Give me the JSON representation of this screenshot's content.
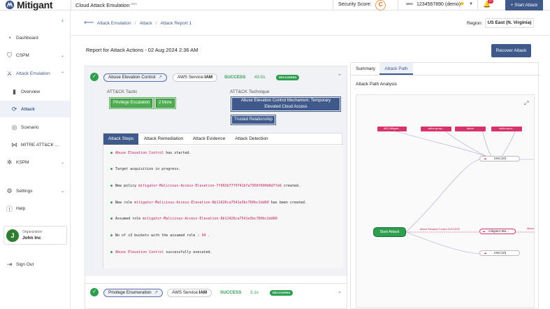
{
  "topbar": {
    "brand": "Mitigant",
    "app_title": "Cloud Attack Emulation",
    "aws_mark": "aws",
    "security_score_label": "Security Score:",
    "security_score_grade": "C",
    "account_aws_mark": "aws",
    "account": "1234567890 (demo)",
    "notification_count": "27",
    "start_attack": "+ Start Attack"
  },
  "sidebar": {
    "items": [
      {
        "label": "Dashboard",
        "icon": "dashboard-icon"
      },
      {
        "label": "CSPM",
        "icon": "cspm-icon"
      },
      {
        "label": "Attack Emulation",
        "icon": "attack-emulation-icon"
      },
      {
        "label": "Overview",
        "icon": "overview-icon"
      },
      {
        "label": "Attack",
        "icon": "attack-icon"
      },
      {
        "label": "Scenario",
        "icon": "scenario-icon"
      },
      {
        "label": "MITRE ATT&CK ...",
        "icon": "mitre-icon"
      },
      {
        "label": "KSPM",
        "icon": "kspm-icon"
      },
      {
        "label": "Settings",
        "icon": "gear-icon"
      },
      {
        "label": "Help",
        "icon": "help-icon"
      },
      {
        "label": "Sign Out",
        "icon": "sign-out-icon"
      }
    ],
    "org": {
      "label": "Organization",
      "name": "John Inc",
      "initial": "J"
    }
  },
  "breadcrumb": {
    "items": [
      "Attack Emulation",
      "Attack",
      "Attack Report 1"
    ],
    "sep": "/"
  },
  "region": {
    "label": "Region:",
    "value": "US East (N. Virginia)"
  },
  "report": {
    "title": "Report for Attack Actions - 02 Aug 2024 2:36 AM",
    "recover_button": "Recover Attack"
  },
  "attack1": {
    "name": "Abuse Elevation Control",
    "service_prefix": "AWS Service:",
    "service": "IAM",
    "status": "SUCCESS",
    "duration": "43.0s",
    "badge": "RECOVERED",
    "tactic_label": "ATT&CK Tactic",
    "tactics": [
      "Privilege Escalation",
      "2 More"
    ],
    "technique_label": "ATT&CK Technique",
    "techniques": [
      "Abuse Elevation Control Mechanism: Temporary Elevated Cloud Access",
      "Trusted Relationship"
    ],
    "tabs": [
      "Attack Steps",
      "Attack Remediation",
      "Attack Evidence",
      "Attack Detection"
    ],
    "logs": [
      {
        "pre": "",
        "hl": "Abuse Elevation Control",
        "post": " has started."
      },
      {
        "pre": "Target acquisition in progress.",
        "hl": "",
        "post": ""
      },
      {
        "pre": "New policy ",
        "hl": "mitigator-Malicious-Access-Elevation-7f993b77f9741b7a7958f600d8d7fe6",
        "post": " created."
      },
      {
        "pre": "New role ",
        "hl": "mitigator-Malicious-Access-Elevation-8b11426ca7541e3bc760bc1dd60",
        "post": " has been created."
      },
      {
        "pre": "Assumed role ",
        "hl": "mitigator-Malicious-Access-Elevation-8b11426ca7541e3bc760bc1dd60",
        "post": ""
      },
      {
        "pre": "No of s3 buckets with the assumed role : ",
        "hl": "94",
        "post": " ."
      },
      {
        "pre": "",
        "hl": "Abuse Elevation Control",
        "post": " successfully executed."
      }
    ]
  },
  "attack2": {
    "name": "Privilege Enumeration",
    "service_prefix": "AWS Service:",
    "service": "IAM",
    "status": "SUCCESS",
    "duration": "3.1s",
    "badge": "RECOVERED"
  },
  "right": {
    "tabs": [
      "Summary",
      "Attack Path"
    ],
    "title": "Attack Path Analysis",
    "graph": {
      "top_nodes": [
        "ABC-Mitigant...",
        "action-group...",
        "Admin",
        "eddie-secur..."
      ],
      "iam_node_top": "IAM (10)",
      "iam_node_bottom": "IAM (10)",
      "mitigator_node": "mitigator-Ma...",
      "start_node": "Start Attack",
      "edge_label": "Abuse Elevation Control SUCCESS",
      "edge_label_right": "Abuse"
    }
  }
}
